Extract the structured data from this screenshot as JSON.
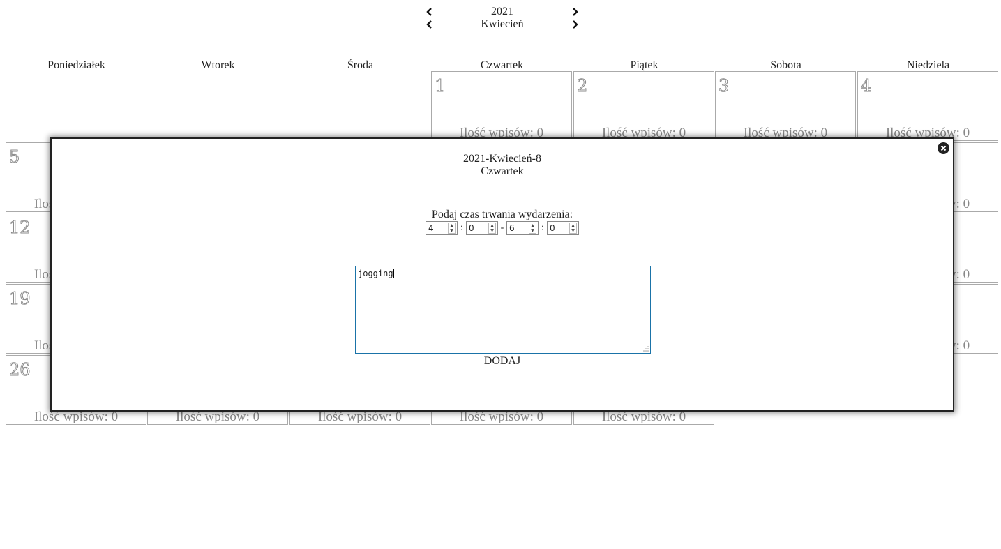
{
  "nav": {
    "year": "2021",
    "month": "Kwiecień"
  },
  "weekdays": [
    "Poniedziałek",
    "Wtorek",
    "Środa",
    "Czwartek",
    "Piątek",
    "Sobota",
    "Niedziela"
  ],
  "entry_count_label": "Ilość wpisów: 0",
  "days": [
    "1",
    "2",
    "3",
    "4",
    "5",
    "12",
    "19",
    "26"
  ],
  "modal": {
    "date": "2021-Kwiecień-8",
    "weekday": "Czwartek",
    "duration_prompt": "Podaj czas trwania wydarzenia:",
    "start_hour": "4",
    "start_minute": "0",
    "end_hour": "6",
    "end_minute": "0",
    "colon": ":",
    "dash": "-",
    "note_text": "jogging",
    "add_label": "DODAJ"
  },
  "icons": {
    "prev": "chevron-left-icon",
    "next": "chevron-right-icon",
    "close": "close-circle-icon"
  }
}
